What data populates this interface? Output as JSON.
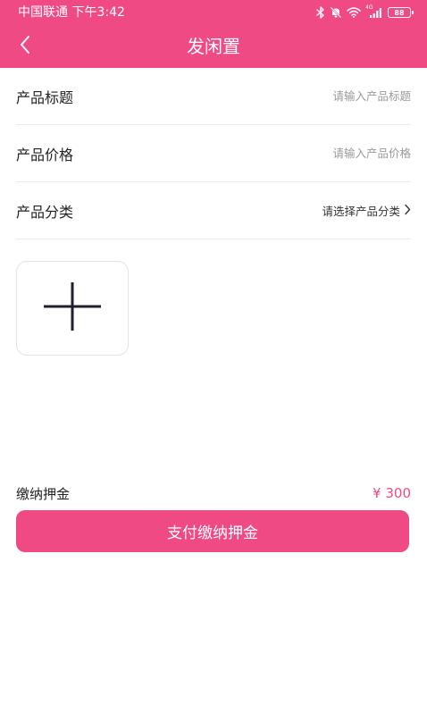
{
  "status_bar": {
    "carrier_time": "中国联通 下午3:42",
    "network": "4G",
    "battery": "88"
  },
  "nav": {
    "title": "发闲置"
  },
  "form": {
    "title": {
      "label": "产品标题",
      "placeholder": "请输入产品标题",
      "value": ""
    },
    "price": {
      "label": "产品价格",
      "placeholder": "请输入产品价格",
      "value": ""
    },
    "category": {
      "label": "产品分类",
      "select_text": "请选择产品分类"
    }
  },
  "deposit": {
    "label": "缴纳押金",
    "amount": "¥ 300"
  },
  "pay_button": {
    "label": "支付缴纳押金"
  },
  "colors": {
    "accent": "#f04a84"
  },
  "icons": {
    "back": "chevron-left-icon",
    "category_arrow": "chevron-right-icon",
    "add_image": "plus-icon"
  }
}
